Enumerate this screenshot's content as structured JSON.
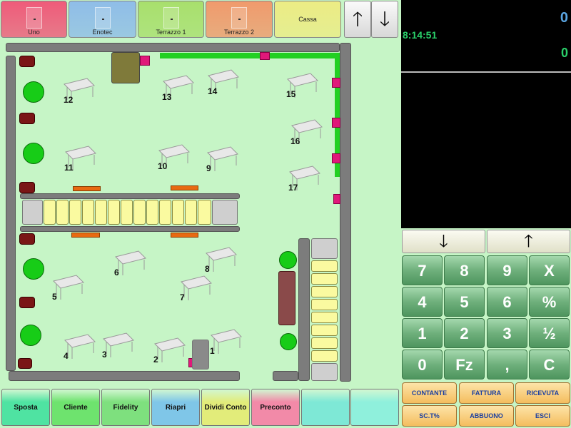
{
  "rooms": [
    {
      "label": "Uno",
      "color": "#ef5b7a"
    },
    {
      "label": "Enotec",
      "color": "#8fbde8"
    },
    {
      "label": "Terrazzo 1",
      "color": "#a8df6c"
    },
    {
      "label": "Terrazzo 2",
      "color": "#f09a6c"
    },
    {
      "label": "Cassa",
      "color": "#ecec84"
    }
  ],
  "nav_arrows": {
    "up": "🡑",
    "down": "🡓",
    "up_icon": "arrow-up-icon",
    "down_icon": "arrow-down-icon"
  },
  "display": {
    "total": "0",
    "time": "8:14:51",
    "count": "0"
  },
  "scroll": {
    "down": "🡓",
    "up": "🡑"
  },
  "keypad": [
    "7",
    "8",
    "9",
    "X",
    "4",
    "5",
    "6",
    "%",
    "1",
    "2",
    "3",
    "½",
    "0",
    "Fz",
    ",",
    "C"
  ],
  "functions": [
    "CONTANTE",
    "FATTURA",
    "RICEVUTA",
    "SC.T%",
    "ABBUONO",
    "ESCI"
  ],
  "bottom_buttons": [
    {
      "label": "Sposta",
      "color": "#4fe3a2"
    },
    {
      "label": "Cliente",
      "color": "#6ee36e"
    },
    {
      "label": "Fidelity",
      "color": "#7ee07e"
    },
    {
      "label": "Riapri",
      "color": "#7fc6e8"
    },
    {
      "label": "Dividi Conto",
      "color": "#e2ec7a"
    },
    {
      "label": "Preconto",
      "color": "#f28aa8"
    },
    {
      "label": "",
      "color": "#7ee8d6"
    },
    {
      "label": "",
      "color": "#8ff0dc"
    }
  ],
  "tables": [
    "12",
    "13",
    "14",
    "15",
    "16",
    "11",
    "10",
    "9",
    "17",
    "6",
    "8",
    "5",
    "7",
    "4",
    "3",
    "2",
    "1"
  ]
}
